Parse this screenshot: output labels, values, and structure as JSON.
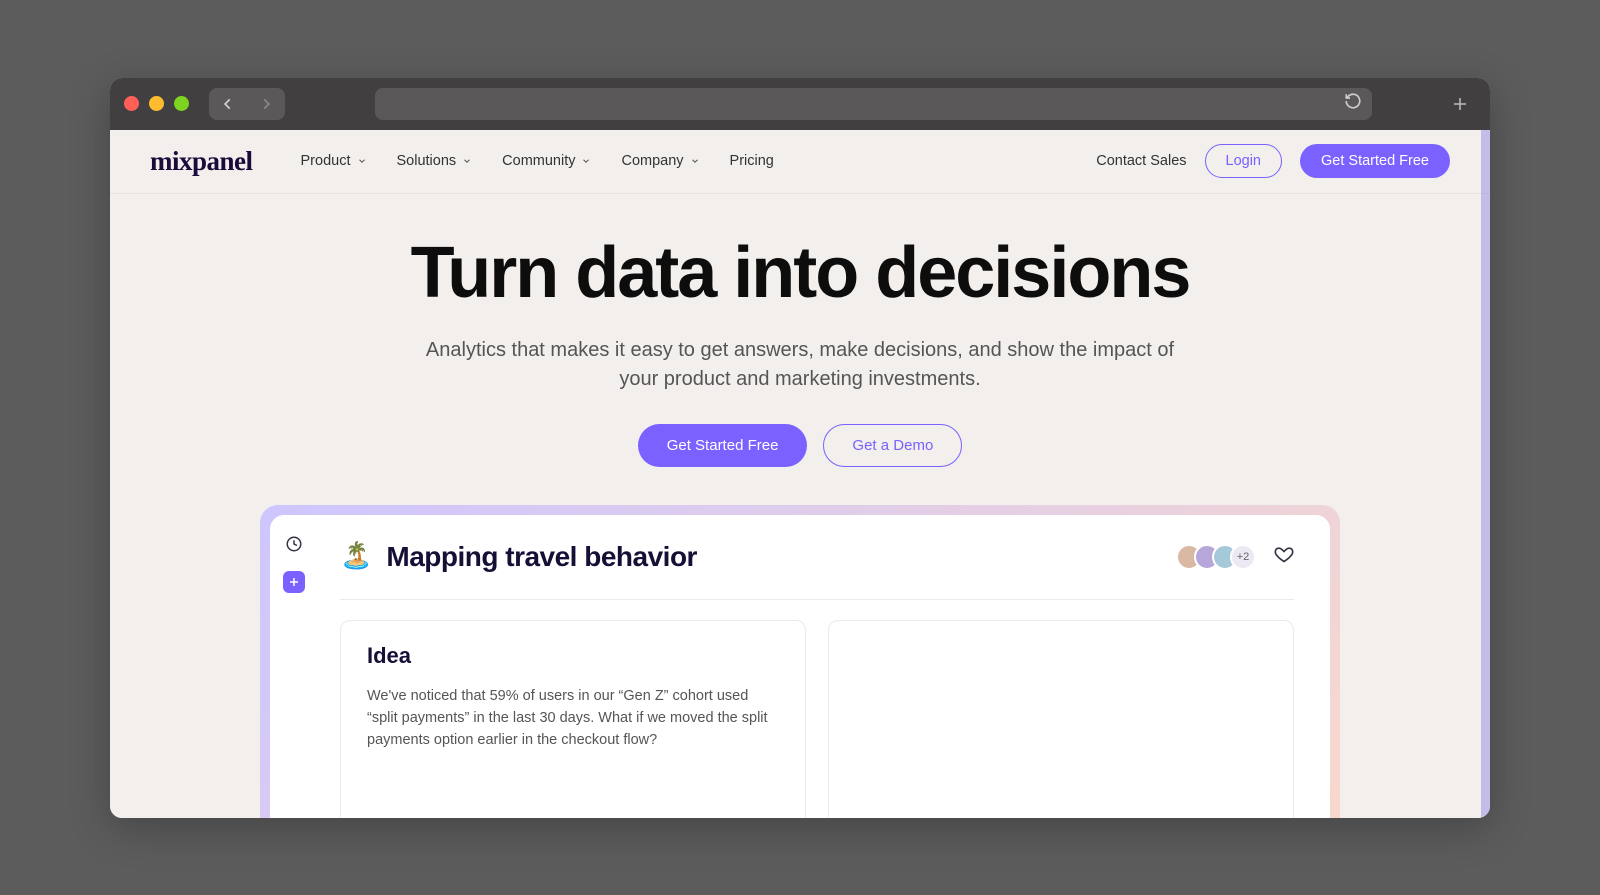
{
  "nav": {
    "logo": "mixpanel",
    "items": [
      {
        "label": "Product",
        "hasChevron": true
      },
      {
        "label": "Solutions",
        "hasChevron": true
      },
      {
        "label": "Community",
        "hasChevron": true
      },
      {
        "label": "Company",
        "hasChevron": true
      },
      {
        "label": "Pricing",
        "hasChevron": false
      }
    ],
    "contact": "Contact Sales",
    "login": "Login",
    "cta": "Get Started Free"
  },
  "hero": {
    "headline": "Turn data into decisions",
    "sub": "Analytics that makes it easy to get answers, make decisions, and show the impact of your product and marketing investments.",
    "primary": "Get Started Free",
    "secondary": "Get a Demo"
  },
  "dashboard": {
    "title": "Mapping travel behavior",
    "avatarOverflow": "+2",
    "card1": {
      "title": "Idea",
      "body": "We've noticed that 59% of users in our “Gen Z” cohort used “split payments” in the last 30 days. What if we moved the split payments option earlier in the checkout flow?"
    }
  }
}
